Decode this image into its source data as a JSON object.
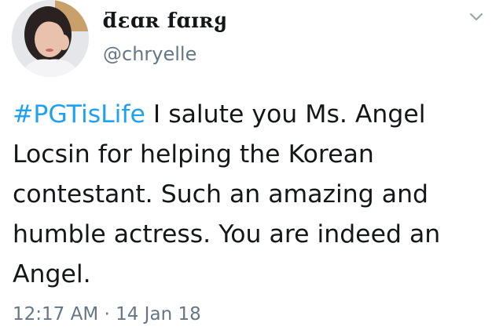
{
  "author": {
    "display_name": "ƌɛɑʀ fɑɪʀყ",
    "handle": "@chryelle",
    "avatar_icon": "profile-photo"
  },
  "header": {
    "menu_icon": "chevron-down-icon"
  },
  "tweet": {
    "hashtag": "#PGTisLife",
    "text": " I salute you Ms. Angel Locsin for helping the Korean contestant. Such an amazing and humble actress. You are indeed an Angel."
  },
  "meta": {
    "time": "12:17 AM",
    "separator": "·",
    "date": "14 Jan 18"
  },
  "colors": {
    "hashtag": "#1da1f2",
    "secondary_text": "#657786",
    "primary_text": "#14171a"
  }
}
